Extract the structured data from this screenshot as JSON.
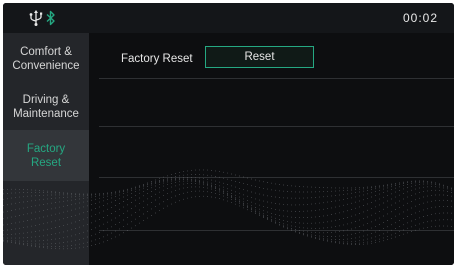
{
  "status_bar": {
    "time": "00:02",
    "icons": [
      "usb-icon",
      "bluetooth-icon"
    ]
  },
  "sidebar": {
    "items": [
      {
        "label": "Comfort &\nConvenience",
        "selected": false
      },
      {
        "label": "Driving &\nMaintenance",
        "selected": false
      },
      {
        "label": "Factory\nReset",
        "selected": true
      }
    ]
  },
  "content": {
    "factory_reset_label": "Factory Reset",
    "reset_button_label": "Reset"
  },
  "colors": {
    "accent": "#25a882",
    "background": "#0d0e10",
    "sidebar": "#24262a",
    "sidebar_selected": "#33363a",
    "text": "#e6e6e6"
  }
}
